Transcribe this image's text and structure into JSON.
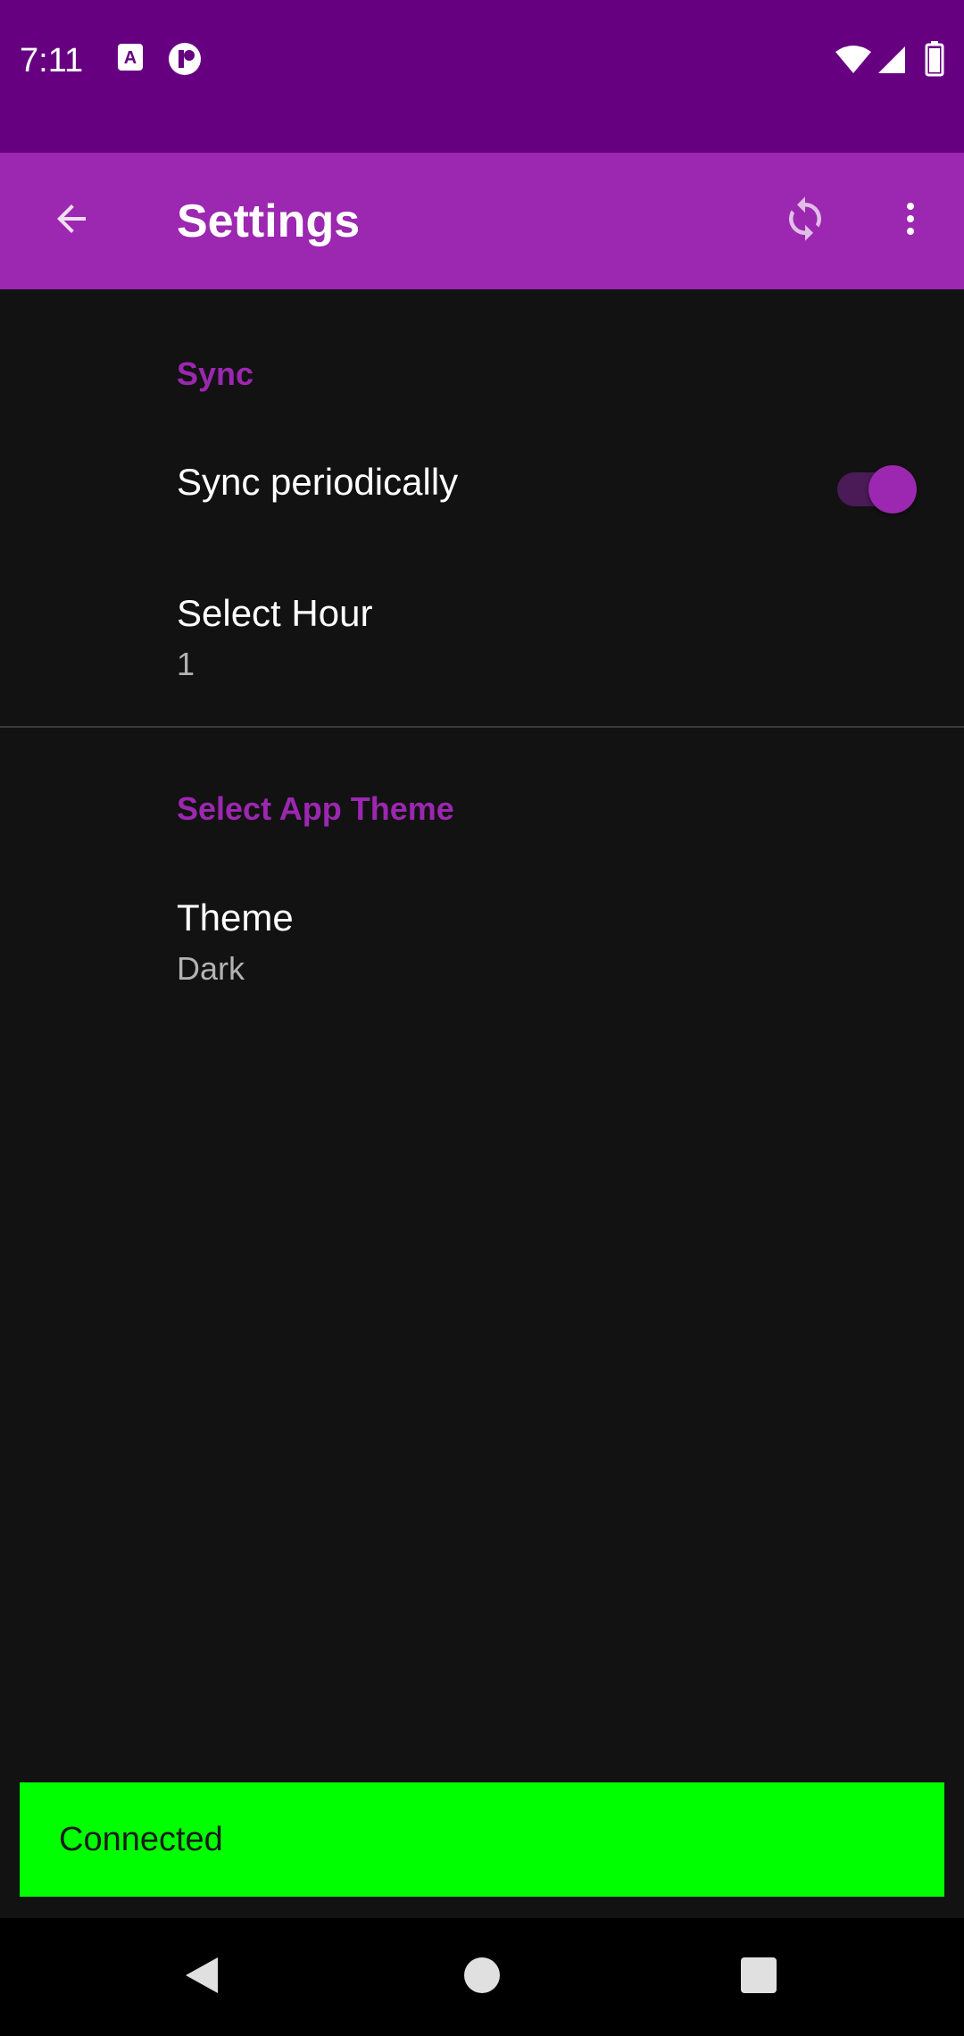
{
  "status_bar": {
    "time": "7:11",
    "icons": [
      "keyboard-a-icon",
      "notification-app-icon",
      "wifi-icon",
      "signal-icon",
      "battery-icon"
    ]
  },
  "app_bar": {
    "title": "Settings",
    "back_icon": "arrow-back-icon",
    "sync_icon": "sync-icon",
    "more_icon": "more-vert-icon"
  },
  "preferences": {
    "sync_category": "Sync",
    "sync_periodically": {
      "title": "Sync periodically",
      "enabled": true
    },
    "select_hour": {
      "title": "Select Hour",
      "summary": "1"
    },
    "theme_category": "Select App Theme",
    "theme": {
      "title": "Theme",
      "summary": "Dark"
    }
  },
  "snackbar": {
    "text": "Connected"
  },
  "nav_bar": {
    "icons": [
      "nav-back-icon",
      "nav-home-icon",
      "nav-recents-icon"
    ]
  },
  "colors": {
    "status_bar": "#660080",
    "app_bar": "#9c27b0",
    "accent": "#9c27b0",
    "background": "#121212",
    "snackbar": "#00ff00"
  }
}
